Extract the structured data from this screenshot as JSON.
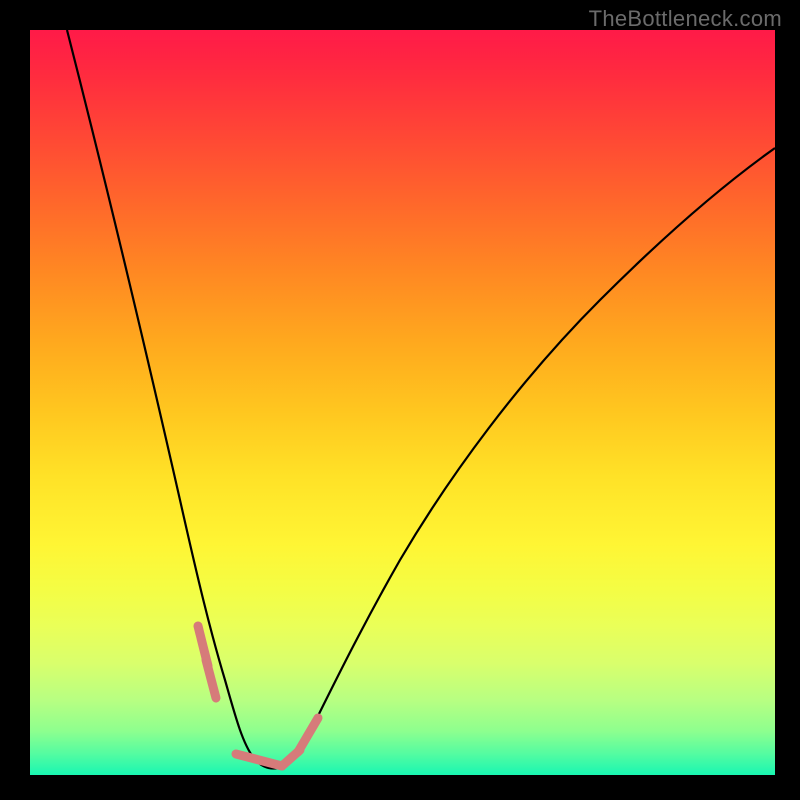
{
  "watermark": "TheBottleneck.com",
  "colors": {
    "page_bg": "#000000",
    "watermark": "#6b6b6b",
    "curve": "#000000",
    "accent_stroke": "#d67b7a",
    "gradient_top": "#ff1a48",
    "gradient_bottom": "#19f7b2"
  },
  "chart_data": {
    "type": "line",
    "title": "",
    "xlabel": "",
    "ylabel": "",
    "xlim": [
      0,
      100
    ],
    "ylim": [
      0,
      100
    ],
    "grid": false,
    "legend": false,
    "note": "V-shaped bottleneck curve over a vertical red-to-green gradient. The minimum of the curve is near x≈30, y≈0. The curve rises steeply to the upper-left edge and with a gentler slope toward the upper-right. Short salmon-colored accent segments sit on the curve near the trough. Values estimated from pixel positions; no axis ticks or labels are shown.",
    "series": [
      {
        "name": "bottleneck-curve",
        "x": [
          5,
          10,
          15,
          20,
          23,
          26,
          28,
          30,
          32,
          34,
          36,
          40,
          48,
          60,
          75,
          90,
          100
        ],
        "y": [
          100,
          79,
          57,
          32,
          16,
          6,
          2,
          0.5,
          0.5,
          1.5,
          4,
          10,
          24,
          41,
          58,
          71,
          78
        ]
      }
    ],
    "accent_segments": [
      {
        "x": [
          21.5,
          23.5
        ],
        "y": [
          20,
          13
        ]
      },
      {
        "x": [
          23.0,
          24.5
        ],
        "y": [
          14,
          9
        ]
      },
      {
        "x": [
          26.5,
          33.5
        ],
        "y": [
          2.5,
          1.5
        ]
      },
      {
        "x": [
          34.0,
          36.5
        ],
        "y": [
          2.5,
          6
        ]
      },
      {
        "x": [
          36.0,
          38.5
        ],
        "y": [
          5,
          9
        ]
      }
    ]
  }
}
